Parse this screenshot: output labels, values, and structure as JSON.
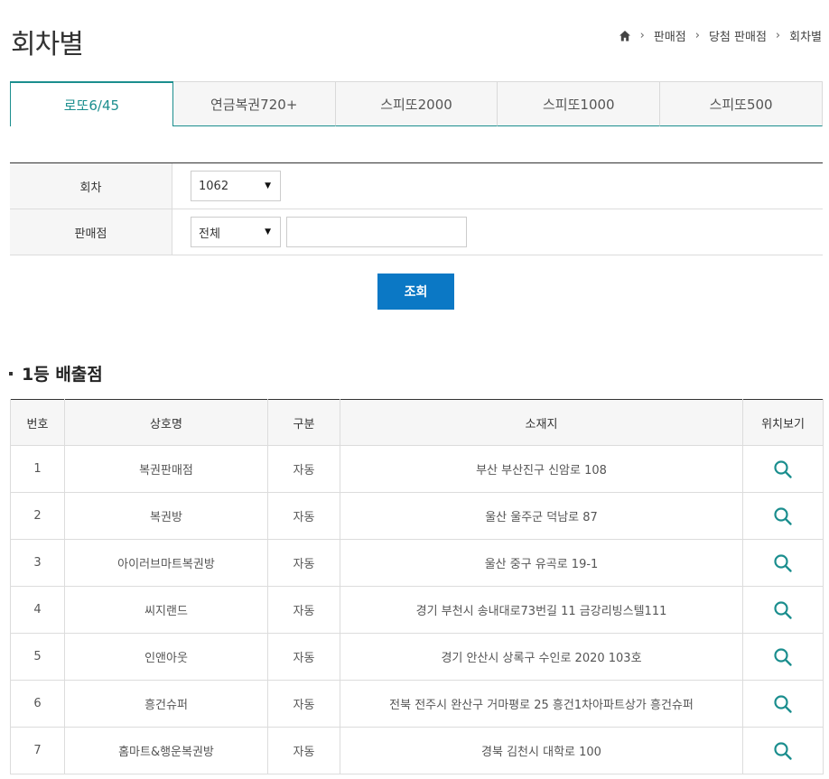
{
  "page": {
    "title": "회차별"
  },
  "breadcrumb": [
    "판매점",
    "당첨 판매점",
    "회차별"
  ],
  "tabs": [
    {
      "label": "로또6/45",
      "active": true
    },
    {
      "label": "연금복권720+",
      "active": false
    },
    {
      "label": "스피또2000",
      "active": false
    },
    {
      "label": "스피또1000",
      "active": false
    },
    {
      "label": "스피또500",
      "active": false
    }
  ],
  "form": {
    "round_label": "회차",
    "round_value": "1062",
    "store_label": "판매점",
    "store_filter_value": "전체",
    "store_input_value": ""
  },
  "submit_label": "조회",
  "section_title": "1등 배출점",
  "table": {
    "headers": [
      "번호",
      "상호명",
      "구분",
      "소재지",
      "위치보기"
    ],
    "rows": [
      [
        "1",
        "복권판매점",
        "자동",
        "부산 부산진구 신암로 108"
      ],
      [
        "2",
        "복권방",
        "자동",
        "울산 울주군 덕남로 87"
      ],
      [
        "3",
        "아이러브마트복권방",
        "자동",
        "울산 중구 유곡로 19-1"
      ],
      [
        "4",
        "씨지랜드",
        "자동",
        "경기 부천시 송내대로73번길 11 금강리빙스텔111"
      ],
      [
        "5",
        "인앤아웃",
        "자동",
        "경기 안산시 상록구 수인로 2020 103호"
      ],
      [
        "6",
        "흥건슈퍼",
        "자동",
        "전북 전주시 완산구 거마평로 25 흥건1차아파트상가 흥건슈퍼"
      ],
      [
        "7",
        "홈마트&행운복권방",
        "자동",
        "경북 김천시 대학로 100"
      ]
    ]
  },
  "colors": {
    "accent": "#1b8e8e",
    "button": "#0b78c5"
  }
}
